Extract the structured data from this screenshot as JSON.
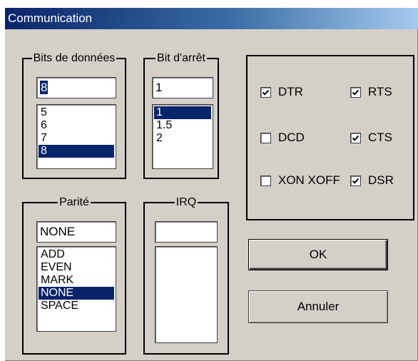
{
  "window": {
    "title": "Communication"
  },
  "data_bits": {
    "label": "Bits de données",
    "value": "8",
    "options": [
      "5",
      "6",
      "7",
      "8"
    ],
    "selected": "8"
  },
  "stop_bits": {
    "label": "Bit d'arrêt",
    "value": "1",
    "options": [
      "1",
      "1.5",
      "2"
    ],
    "selected": "1"
  },
  "parity": {
    "label": "Parité",
    "value": "NONE",
    "options": [
      "ADD",
      "EVEN",
      "MARK",
      "NONE",
      "SPACE"
    ],
    "selected": "NONE"
  },
  "irq": {
    "label": "IRQ",
    "value": "",
    "options": []
  },
  "signals": {
    "dtr": {
      "label": "DTR",
      "checked": true
    },
    "rts": {
      "label": "RTS",
      "checked": true
    },
    "dcd": {
      "label": "DCD",
      "checked": false
    },
    "cts": {
      "label": "CTS",
      "checked": true
    },
    "xon_xoff": {
      "label": "XON XOFF",
      "checked": false
    },
    "dsr": {
      "label": "DSR",
      "checked": true
    }
  },
  "buttons": {
    "ok": "OK",
    "cancel": "Annuler"
  }
}
